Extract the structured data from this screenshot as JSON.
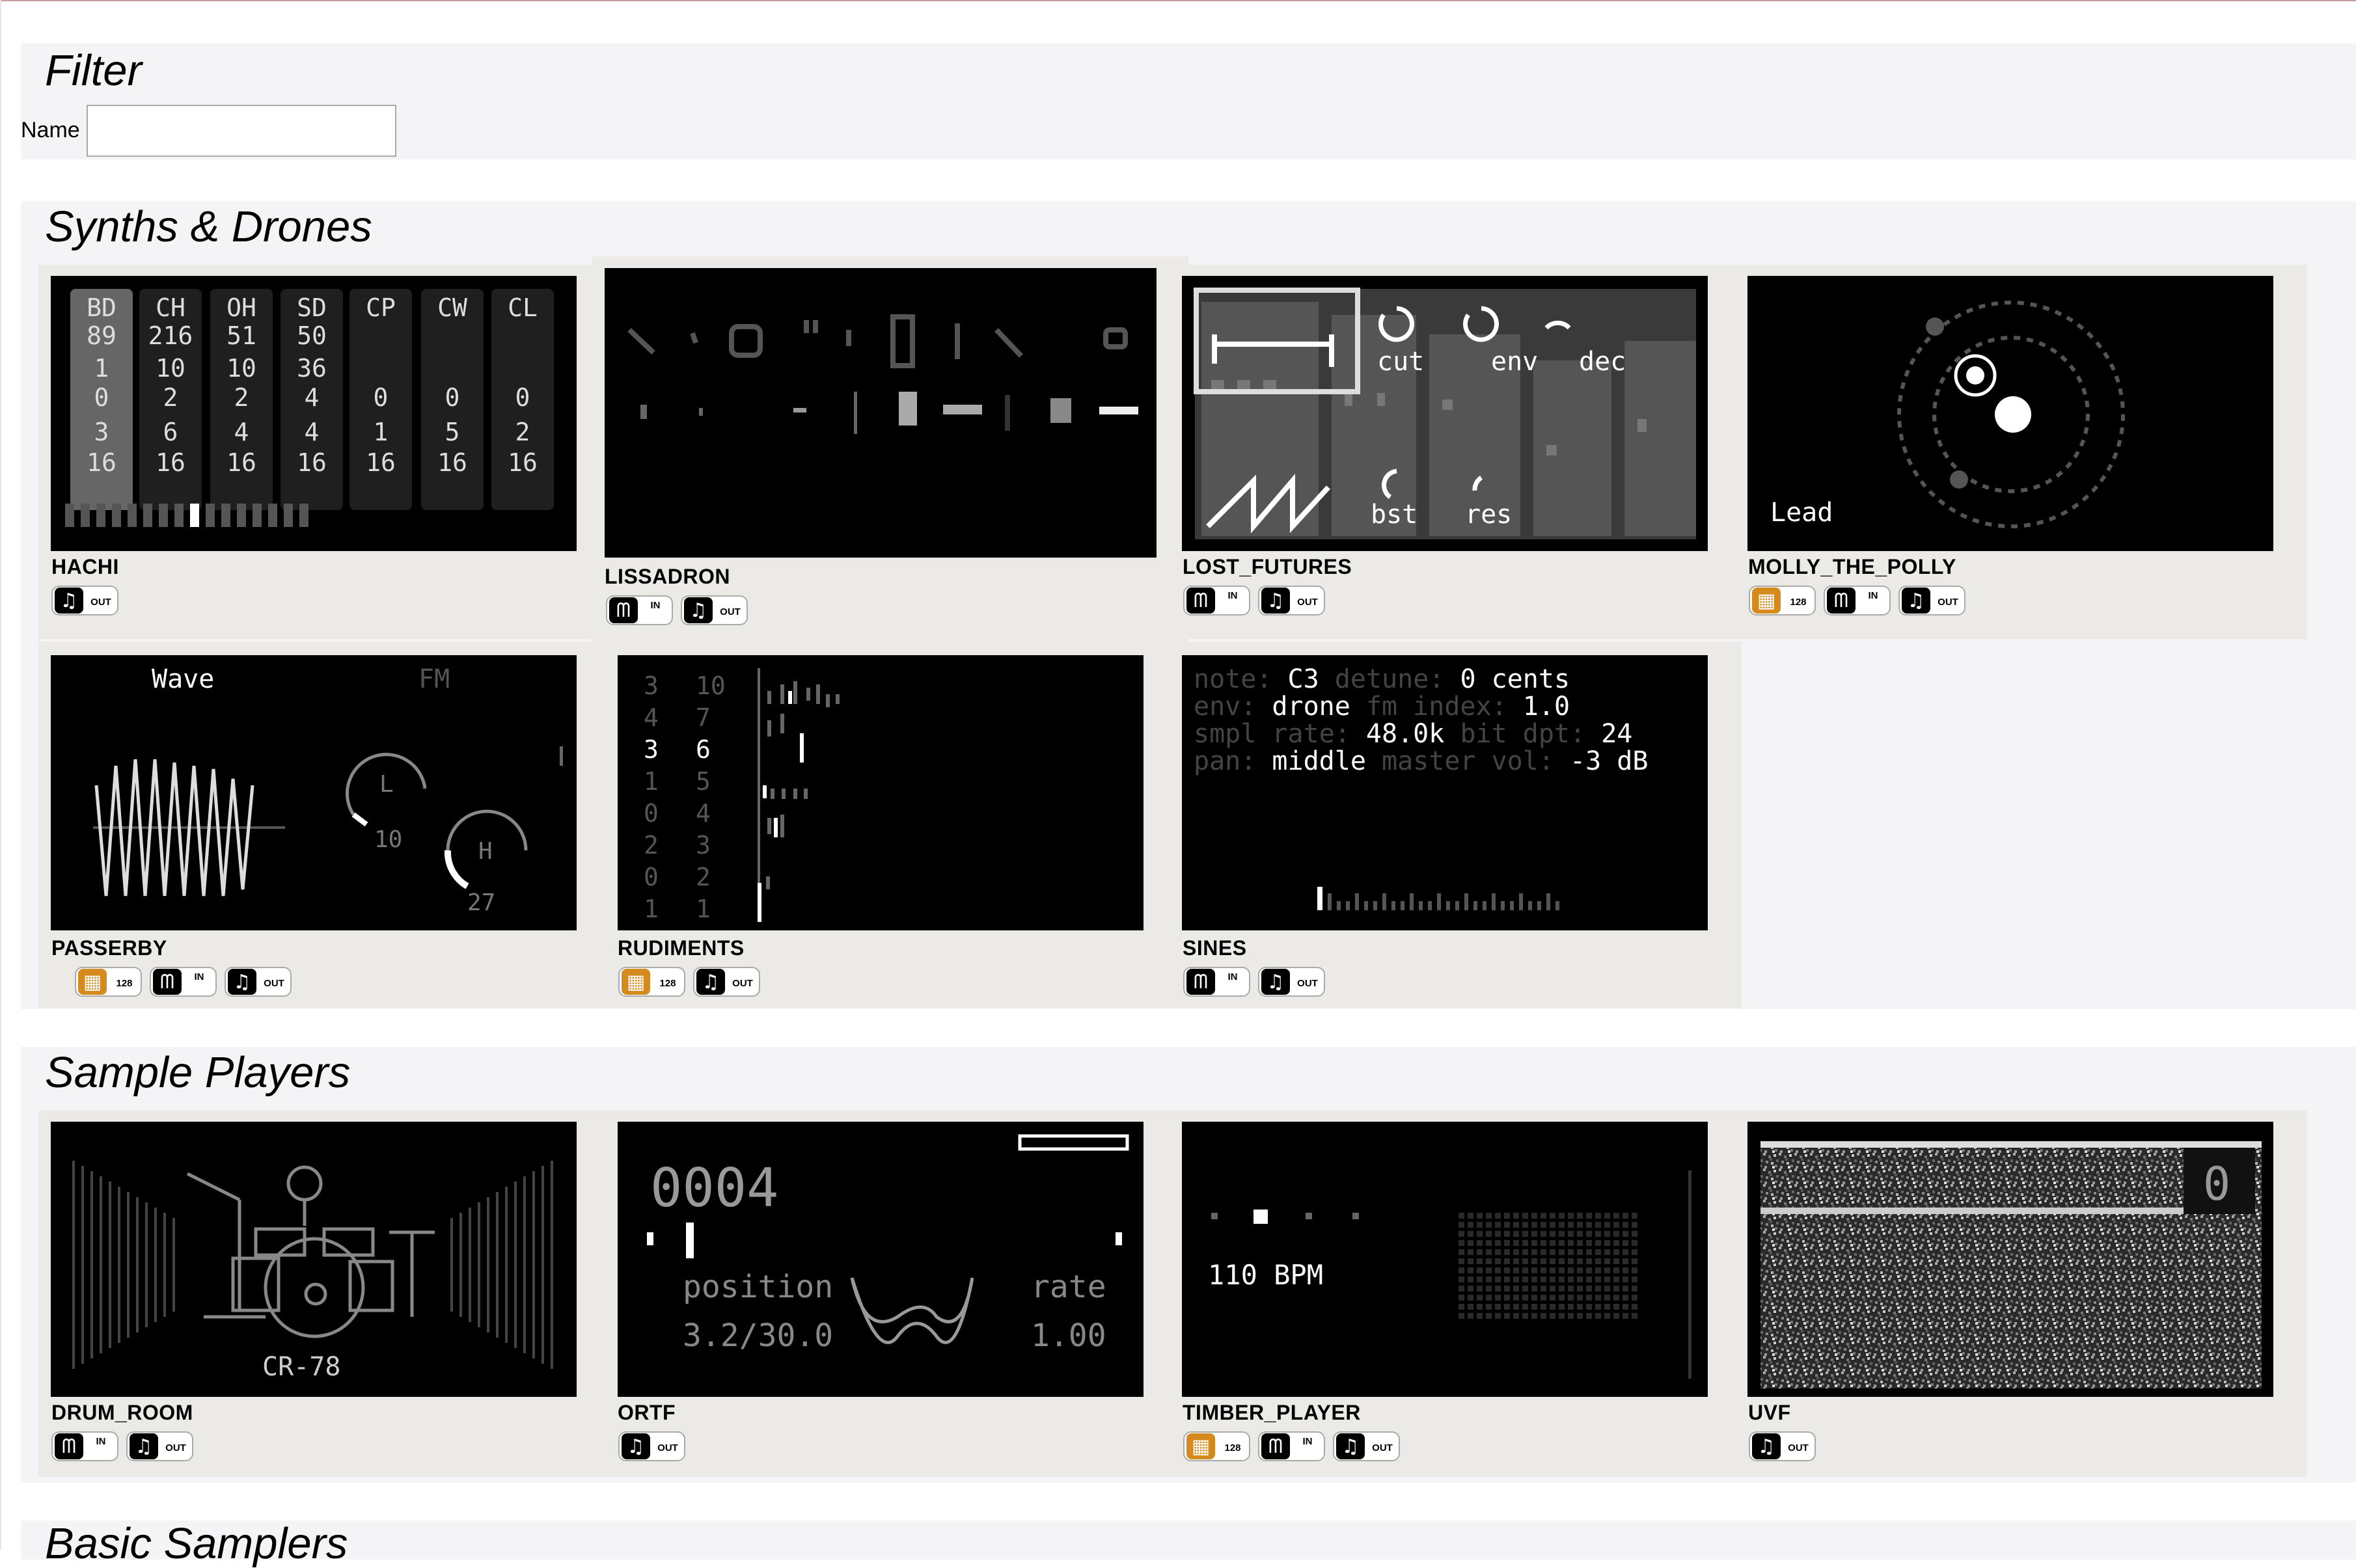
{
  "filter": {
    "title": "Filter",
    "name_label": "Name",
    "name_value": "",
    "name_placeholder": ""
  },
  "sections": {
    "synths": "Synths & Drones",
    "samples": "Sample Players",
    "basic": "Basic Samplers"
  },
  "badge_labels": {
    "grid": "128",
    "midi_in": "IN",
    "audio_out": "OUT"
  },
  "cards": {
    "hachi": "HACHI",
    "lissadron": "LISSADRON",
    "lost_futures": "LOST_FUTURES",
    "molly_the_polly": "MOLLY_THE_POLLY",
    "passerby": "PASSERBY",
    "rudiments": "RUDIMENTS",
    "sines": "SINES",
    "drum_room": "DRUM_ROOM",
    "ortf": "ORTF",
    "timber_player": "TIMBER_PLAYER",
    "uvf": "UVF"
  },
  "screens": {
    "hachi": {
      "columns": [
        {
          "head": "BD",
          "rows": [
            "89",
            "1",
            "0",
            "3",
            "16"
          ]
        },
        {
          "head": "CH",
          "rows": [
            "216",
            "10",
            "2",
            "6",
            "16"
          ]
        },
        {
          "head": "OH",
          "rows": [
            "51",
            "10",
            "2",
            "4",
            "16"
          ]
        },
        {
          "head": "SD",
          "rows": [
            "50",
            "36",
            "4",
            "4",
            "16"
          ]
        },
        {
          "head": "CP",
          "rows": [
            "",
            "",
            "0",
            "1",
            "16"
          ]
        },
        {
          "head": "CW",
          "rows": [
            "",
            "",
            "0",
            "5",
            "16"
          ]
        },
        {
          "head": "CL",
          "rows": [
            "",
            "",
            "0",
            "2",
            "16"
          ]
        }
      ]
    },
    "lost_futures": {
      "knobs": [
        "cut",
        "env",
        "dec",
        "bst",
        "res"
      ]
    },
    "molly": {
      "label": "Lead"
    },
    "passerby": {
      "wave": "Wave",
      "fm": "FM",
      "knob_l": "L",
      "knob_l_val": "10",
      "knob_h": "H",
      "knob_h_val": "27"
    },
    "rudiments": {
      "left": [
        "3",
        "4",
        "3",
        "1",
        "0",
        "2",
        "0",
        "1"
      ],
      "right": [
        "10",
        "7",
        "6",
        "5",
        "4",
        "3",
        "2",
        "1"
      ]
    },
    "sines": {
      "l1a": "note:",
      "l1b": "C3",
      "l1c": "detune:",
      "l1d": "0 cents",
      "l2a": "env:",
      "l2b": "drone",
      "l2c": "fm index:",
      "l2d": "1.0",
      "l3a": "smpl rate:",
      "l3b": "48.0k",
      "l3c": "bit dpt:",
      "l3d": "24",
      "l4a": "pan:",
      "l4b": "middle",
      "l4c": "master vol:",
      "l4d": "-3 dB"
    },
    "drum_room": {
      "label": "CR-78"
    },
    "ortf": {
      "counter": "0004",
      "position_label": "position",
      "position_value": "3.2/30.0",
      "rate_label": "rate",
      "rate_value": "1.00"
    },
    "timber": {
      "bpm": "110 BPM"
    },
    "uvf": {
      "number": "0"
    }
  },
  "icons": {
    "grid": "grid-icon",
    "midi": "midi-icon",
    "audio": "music-note-icon"
  },
  "colors": {
    "grid_icon": "#d48a1c",
    "screen_bg": "#000000",
    "section_bg": "#f4f4f6",
    "card_bg": "#eceae7"
  }
}
